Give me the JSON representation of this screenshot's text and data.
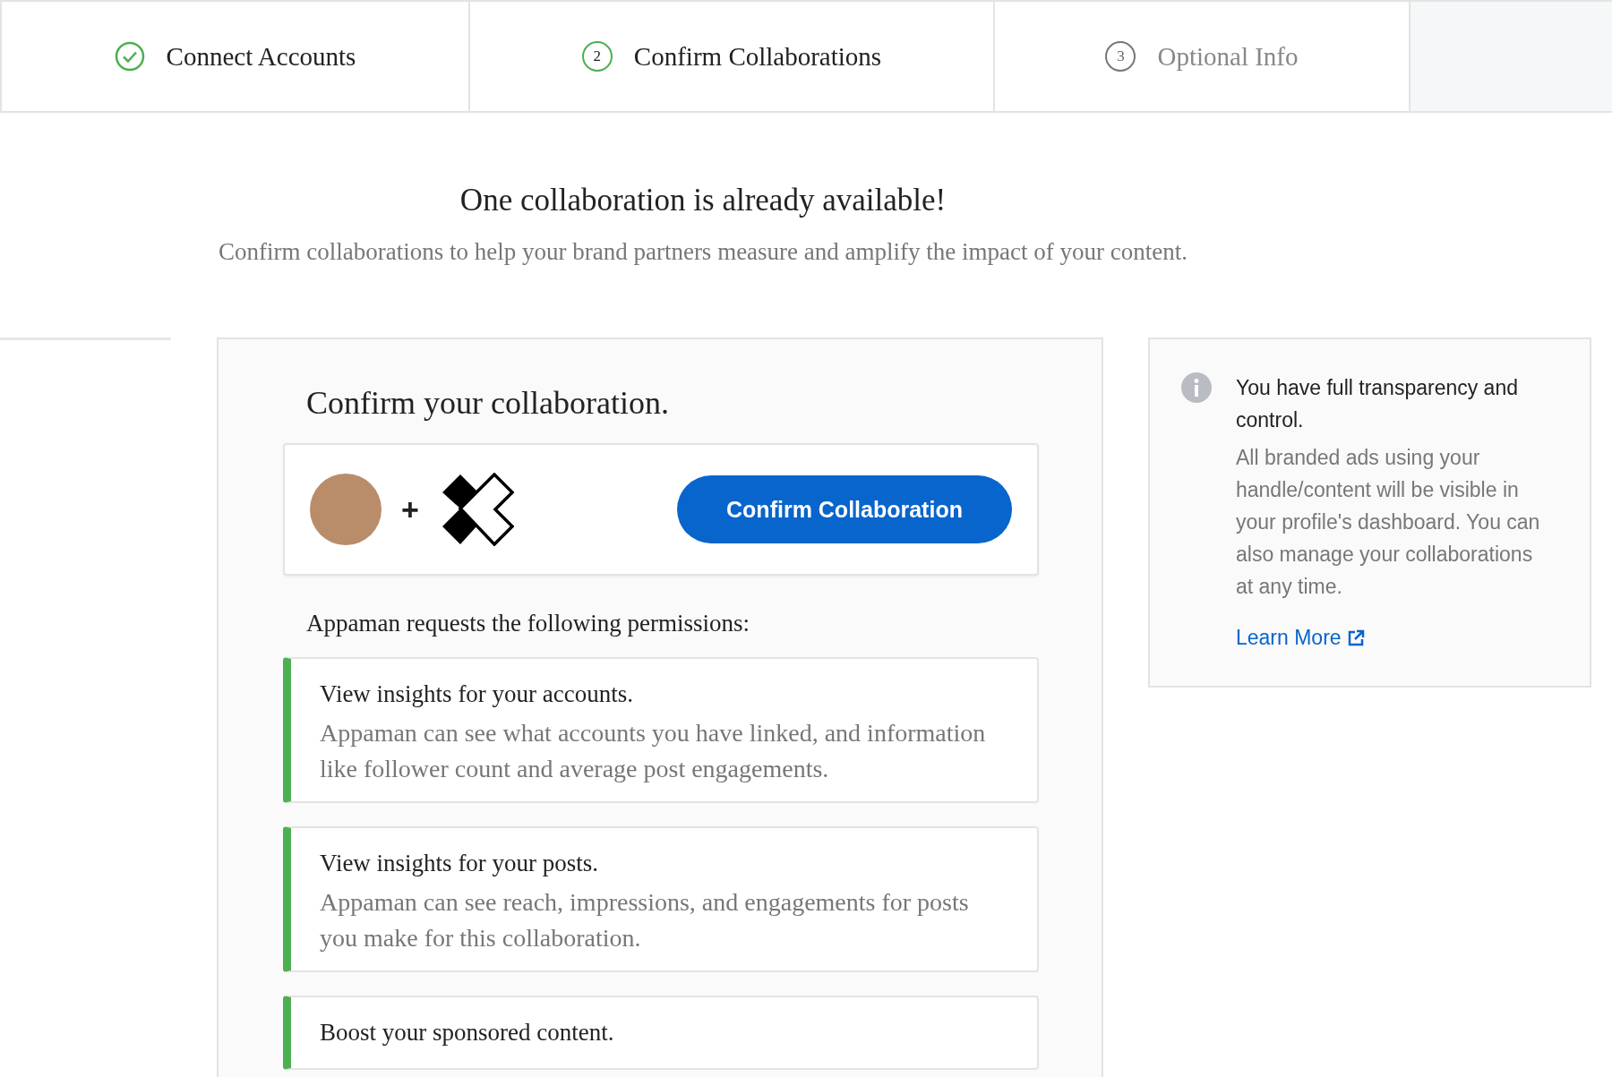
{
  "steps": [
    {
      "label": "Connect Accounts",
      "kind": "done"
    },
    {
      "label": "Confirm Collaborations",
      "number": "2",
      "kind": "current"
    },
    {
      "label": "Optional Info",
      "number": "3",
      "kind": "pending"
    }
  ],
  "heading": "One collaboration is already available!",
  "subheading": "Confirm collaborations to help your brand partners measure and amplify the impact of your content.",
  "card": {
    "title": "Confirm your collaboration.",
    "plus": "+",
    "confirm_button": "Confirm Collaboration",
    "permissions_label": "Appaman requests the following permissions:",
    "permissions": [
      {
        "title": "View insights for your accounts.",
        "description": "Appaman can see what accounts you have linked, and information like follower count and average post engagements."
      },
      {
        "title": "View insights for your posts.",
        "description": "Appaman can see reach, impressions, and engagements for posts you make for this collaboration."
      },
      {
        "title": "Boost your sponsored content."
      }
    ]
  },
  "info": {
    "title": "You have full transparency and control.",
    "body": "All branded ads using your handle/content will be visible in your profile's dashboard. You can also manage your collaborations at any time.",
    "link": "Learn More"
  }
}
